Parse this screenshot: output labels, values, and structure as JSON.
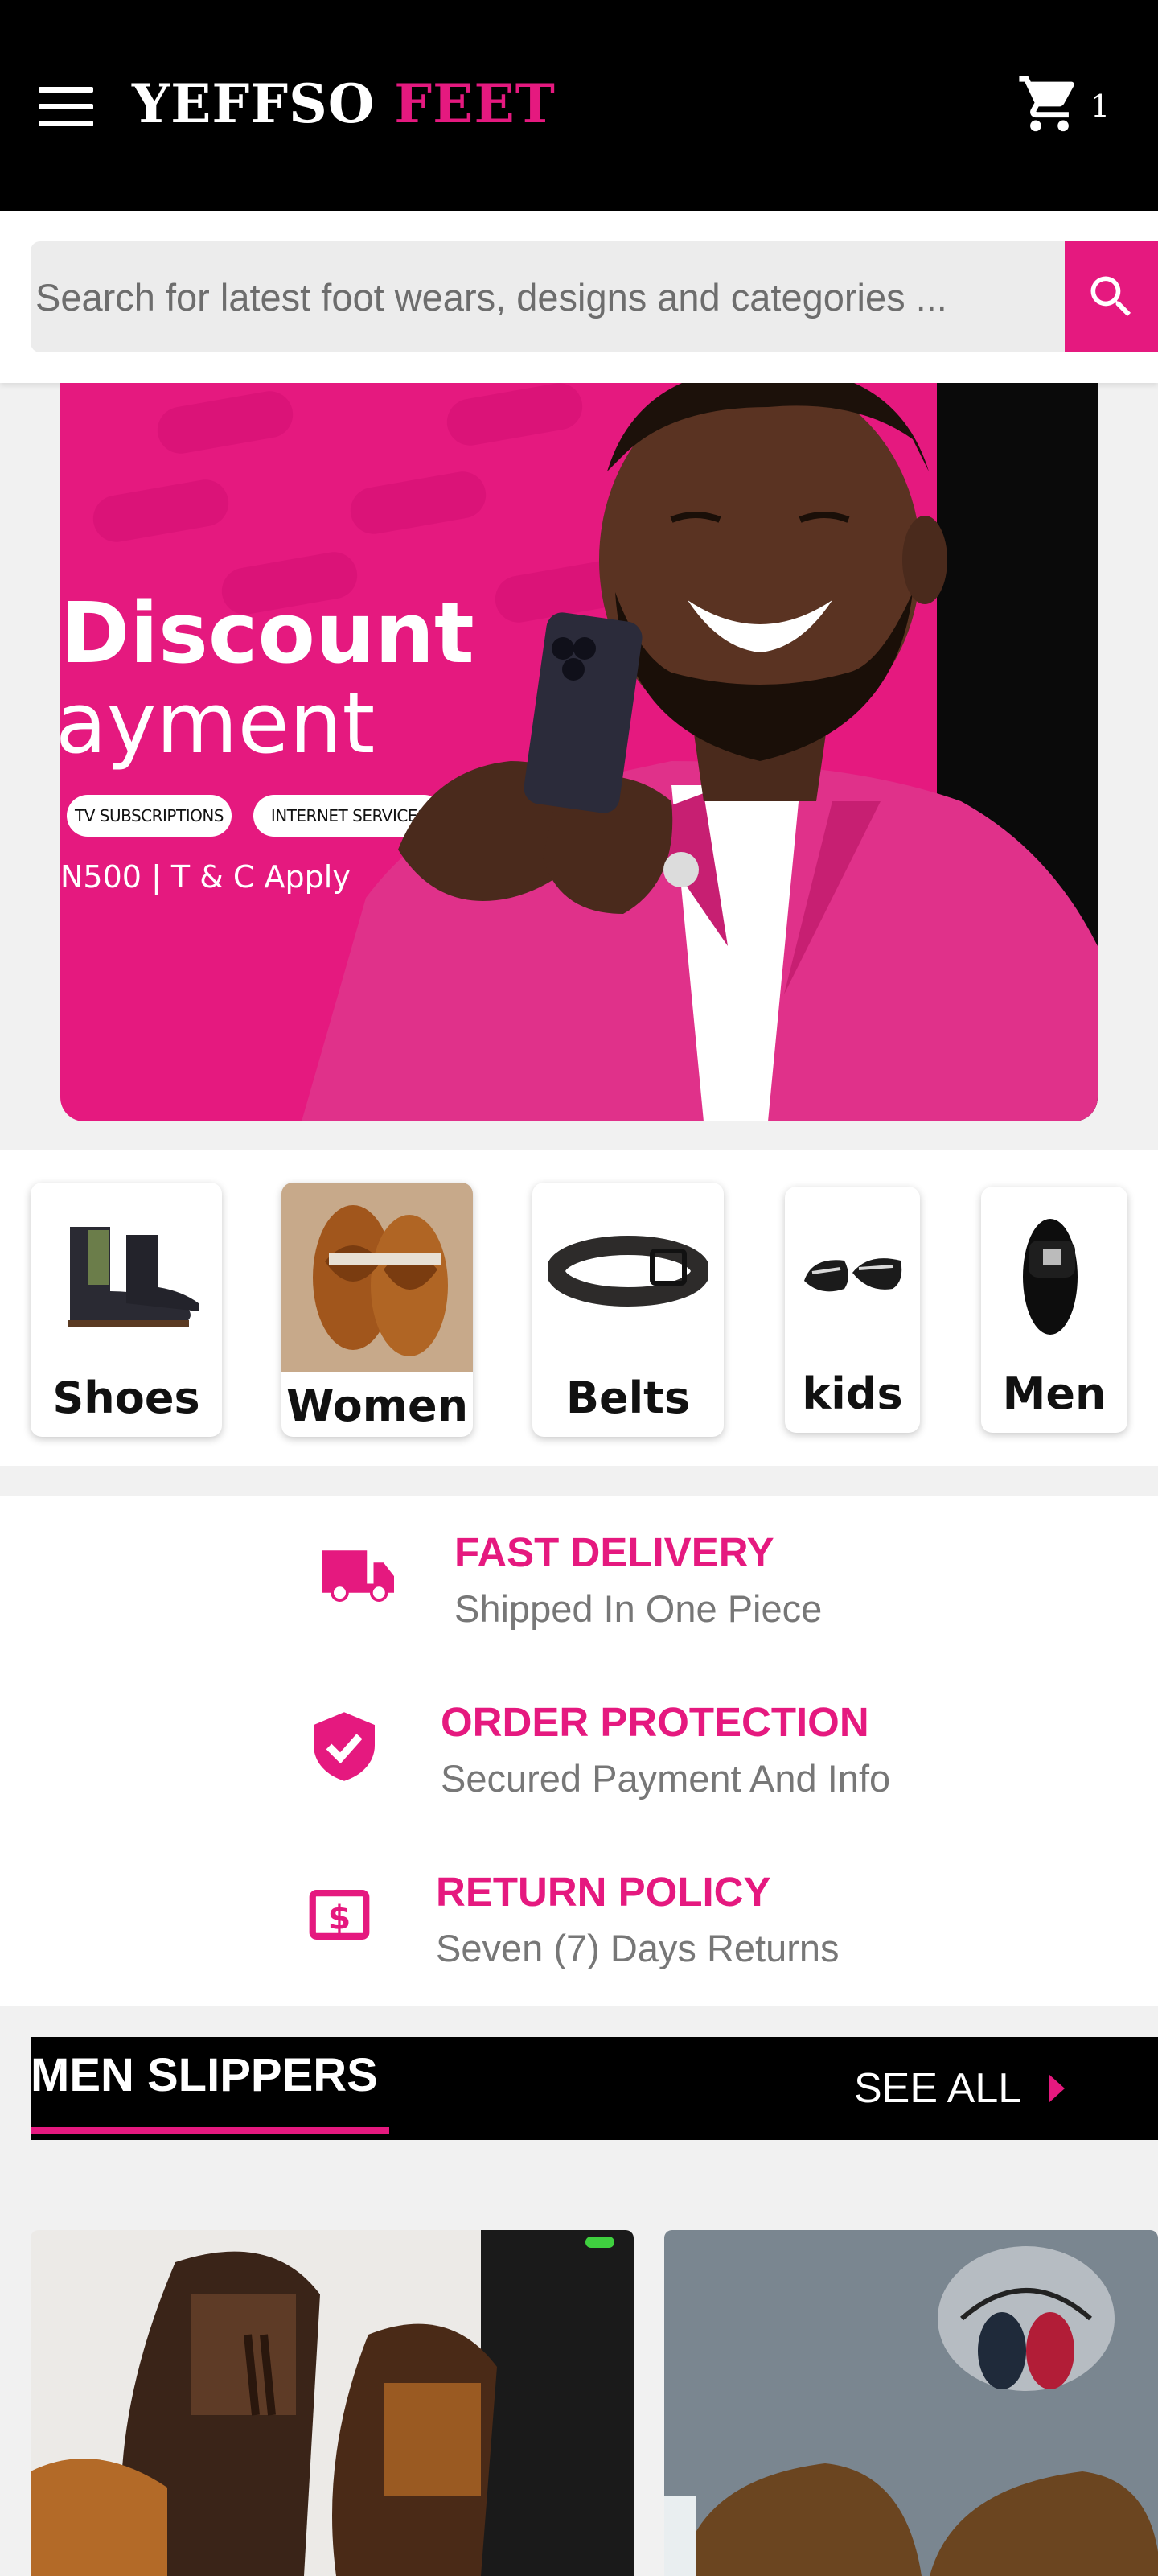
{
  "header": {
    "brand_main": "YEFFSO",
    "brand_accent": "FEET",
    "cart_count": "1"
  },
  "search": {
    "placeholder": "Search for latest foot wears, designs and categories ..."
  },
  "banner": {
    "title": "Discount",
    "subtitle": "ayment",
    "pills": [
      "TV SUBSCRIPTIONS",
      "INTERNET SERVICES"
    ],
    "note": "N500 | T & C Apply"
  },
  "categories": [
    {
      "label": "Shoes",
      "icon": "chelsea-boot-icon"
    },
    {
      "label": "Women",
      "icon": "sandal-icon"
    },
    {
      "label": "Belts",
      "icon": "belt-icon"
    },
    {
      "label": "kids",
      "icon": "kids-sandal-icon"
    },
    {
      "label": "Men",
      "icon": "slipper-icon"
    }
  ],
  "features": [
    {
      "title": "FAST DELIVERY",
      "subtitle": "Shipped In One Piece",
      "icon": "truck-icon"
    },
    {
      "title": "ORDER PROTECTION",
      "subtitle": "Secured Payment And Info",
      "icon": "shield-check-icon"
    },
    {
      "title": "RETURN POLICY",
      "subtitle": "Seven (7) Days Returns",
      "icon": "money-icon"
    }
  ],
  "section": {
    "title": "MEN SLIPPERS",
    "see_all": "SEE ALL"
  },
  "colors": {
    "accent": "#e5197f",
    "header_bg": "#000000"
  }
}
